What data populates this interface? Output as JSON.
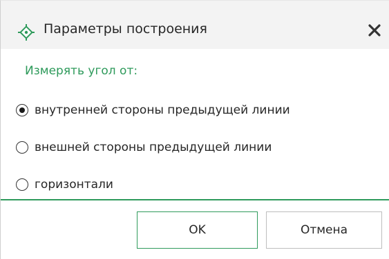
{
  "window": {
    "title": "Параметры построения",
    "icon": "green-diamond-crosshair-icon",
    "close_icon": "close-x-icon"
  },
  "section": {
    "label": "Измерять угол от:"
  },
  "options": [
    {
      "label": "внутренней стороны предыдущей линии",
      "selected": true
    },
    {
      "label": "внешней стороны предыдущей линии",
      "selected": false
    },
    {
      "label": "горизонтали",
      "selected": false
    }
  ],
  "buttons": {
    "ok_label": "OK",
    "cancel_label": "Отмена"
  },
  "colors": {
    "accent": "#2e9a5b",
    "titlebar_bg": "#f3f3f3",
    "text": "#262626"
  }
}
